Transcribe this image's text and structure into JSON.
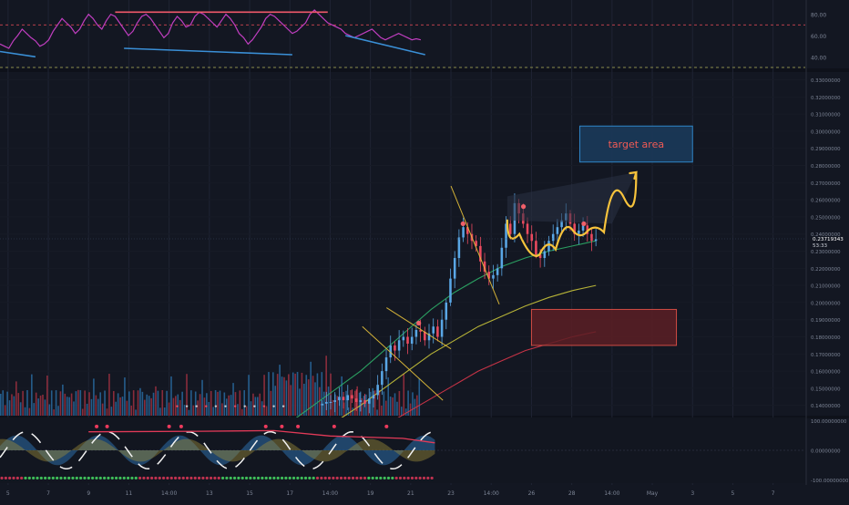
{
  "chart_data": [
    {
      "type": "line",
      "panel": "oscillator-top",
      "ylim": [
        30,
        90
      ],
      "tick_labels": [
        "80.00",
        "60.00",
        "40.00"
      ],
      "tick_values": [
        80,
        60,
        40
      ],
      "levels": [
        70,
        30
      ],
      "series": [
        {
          "color": "#c03ec0",
          "values": [
            52,
            50,
            48,
            55,
            60,
            66,
            62,
            58,
            55,
            50,
            52,
            56,
            64,
            70,
            76,
            72,
            68,
            62,
            66,
            74,
            80,
            76,
            70,
            66,
            74,
            80,
            78,
            72,
            66,
            60,
            64,
            72,
            78,
            80,
            76,
            70,
            64,
            58,
            62,
            72,
            78,
            74,
            68,
            70,
            78,
            82,
            80,
            76,
            72,
            68,
            74,
            80,
            76,
            70,
            62,
            58,
            52,
            56,
            62,
            68,
            76,
            80,
            78,
            74,
            70,
            66,
            62,
            64,
            68,
            72,
            80,
            84,
            80,
            76,
            72,
            70,
            68,
            66,
            62,
            60,
            58,
            60,
            62,
            64,
            66,
            62,
            58,
            56,
            58,
            60,
            62,
            60,
            58,
            56,
            57,
            56
          ]
        }
      ],
      "divergence_lines": [
        {
          "color": "#f0586a",
          "from": [
            26,
            82
          ],
          "to": [
            74,
            82
          ]
        },
        {
          "color": "#3a8fd6",
          "from": [
            28,
            48
          ],
          "to": [
            66,
            42
          ]
        },
        {
          "color": "#3a8fd6",
          "from": [
            78,
            60
          ],
          "to": [
            96,
            42
          ]
        },
        {
          "color": "#3a8fd6",
          "from": [
            0,
            45
          ],
          "to": [
            8,
            40
          ]
        }
      ]
    },
    {
      "type": "candlestick",
      "panel": "price",
      "ylim": [
        0.134,
        0.334
      ],
      "tick_labels": [
        "0.33000000",
        "0.32000000",
        "0.31000000",
        "0.30000000",
        "0.29000000",
        "0.28000000",
        "0.27000000",
        "0.26000000",
        "0.25000000",
        "0.24000000",
        "0.23000000",
        "0.22000000",
        "0.21000000",
        "0.20000000",
        "0.19000000",
        "0.18000000",
        "0.17000000",
        "0.16000000",
        "0.15000000",
        "0.14000000"
      ],
      "tick_values": [
        0.33,
        0.32,
        0.31,
        0.3,
        0.29,
        0.28,
        0.27,
        0.26,
        0.25,
        0.24,
        0.23,
        0.22,
        0.21,
        0.2,
        0.19,
        0.18,
        0.17,
        0.16,
        0.15,
        0.14
      ],
      "last_price": "0.23719343",
      "countdown": "53:33",
      "closes": [
        0.141,
        0.142,
        0.142,
        0.143,
        0.145,
        0.143,
        0.146,
        0.144,
        0.142,
        0.143,
        0.141,
        0.144,
        0.146,
        0.152,
        0.16,
        0.168,
        0.175,
        0.172,
        0.178,
        0.18,
        0.176,
        0.18,
        0.184,
        0.183,
        0.178,
        0.182,
        0.186,
        0.18,
        0.19,
        0.2,
        0.214,
        0.226,
        0.238,
        0.244,
        0.24,
        0.236,
        0.233,
        0.224,
        0.218,
        0.214,
        0.216,
        0.22,
        0.232,
        0.246,
        0.24,
        0.258,
        0.252,
        0.246,
        0.24,
        0.236,
        0.228,
        0.226,
        0.23,
        0.236,
        0.24,
        0.244,
        0.248,
        0.252,
        0.246,
        0.24,
        0.242,
        0.245,
        0.24,
        0.236,
        0.237
      ],
      "x_start": 40,
      "x_end": 74,
      "ma_series": [
        {
          "color": "#2eae68",
          "values": [
            0.13,
            0.14,
            0.15,
            0.16,
            0.172,
            0.184,
            0.196,
            0.206,
            0.214,
            0.221,
            0.226,
            0.23,
            0.233,
            0.236
          ]
        },
        {
          "color": "#c9c43a",
          "values": [
            0.118,
            0.124,
            0.131,
            0.14,
            0.15,
            0.16,
            0.17,
            0.178,
            0.186,
            0.192,
            0.198,
            0.203,
            0.207,
            0.21
          ]
        },
        {
          "color": "#d9364a",
          "values": [
            0.1,
            0.108,
            0.114,
            0.12,
            0.128,
            0.136,
            0.144,
            0.152,
            0.16,
            0.166,
            0.172,
            0.176,
            0.18,
            0.183
          ]
        }
      ],
      "ma_x_start": 36,
      "ma_x_end": 74,
      "projection": [
        [
          63,
          0.248
        ],
        [
          66,
          0.232
        ],
        [
          68,
          0.224
        ],
        [
          70,
          0.238
        ],
        [
          72,
          0.248
        ],
        [
          74,
          0.236
        ],
        [
          76,
          0.246
        ],
        [
          79,
          0.276
        ]
      ],
      "target_zone": {
        "label": "target area",
        "x0": 72,
        "x1": 86,
        "y0": 0.282,
        "y1": 0.303
      },
      "support_zone": {
        "x0": 66,
        "x1": 84,
        "y0": 0.175,
        "y1": 0.196
      },
      "pattern_lines": [
        {
          "color": "#e8c23a",
          "from": [
            56,
            0.268
          ],
          "to": [
            62,
            0.199
          ]
        },
        {
          "color": "#e8c23a",
          "from": [
            48,
            0.197
          ],
          "to": [
            56,
            0.173
          ]
        },
        {
          "color": "#e8c23a",
          "from": [
            45,
            0.186
          ],
          "to": [
            55,
            0.143
          ]
        }
      ],
      "signal_dots": [
        [
          52,
          0.188
        ],
        [
          57.5,
          0.246
        ],
        [
          65,
          0.256
        ],
        [
          72.5,
          0.246
        ]
      ],
      "volume_colors": {
        "up": "#2a6fa8",
        "down": "#a83242"
      }
    },
    {
      "type": "area",
      "panel": "oscillator-bottom",
      "ylim": [
        -110,
        110
      ],
      "tick_labels": [
        "100.00000000",
        "0.00000000",
        "-100.00000000"
      ],
      "tick_values": [
        100,
        0,
        -100
      ],
      "dot_row_value": -93
    }
  ],
  "x_axis": {
    "labels": [
      "5",
      "7",
      "9",
      "11",
      "14:00",
      "13",
      "15",
      "17",
      "14:00",
      "19",
      "21",
      "23",
      "14:00",
      "26",
      "28",
      "14:00",
      "May",
      "3",
      "5",
      "7"
    ]
  },
  "colors": {
    "background": "#131722",
    "grid": "#1f2433",
    "axis_text": "#7d8596",
    "candle_up": "#5aa7e6",
    "candle_down": "#ec4a5f",
    "projection": "#f7c33c",
    "target_zone_fill": "#1b3a5a",
    "target_zone_border": "#2f86c8",
    "target_label": "#f05a55",
    "support_zone_fill": "#5c1e24",
    "support_zone_border": "#d14c44"
  }
}
